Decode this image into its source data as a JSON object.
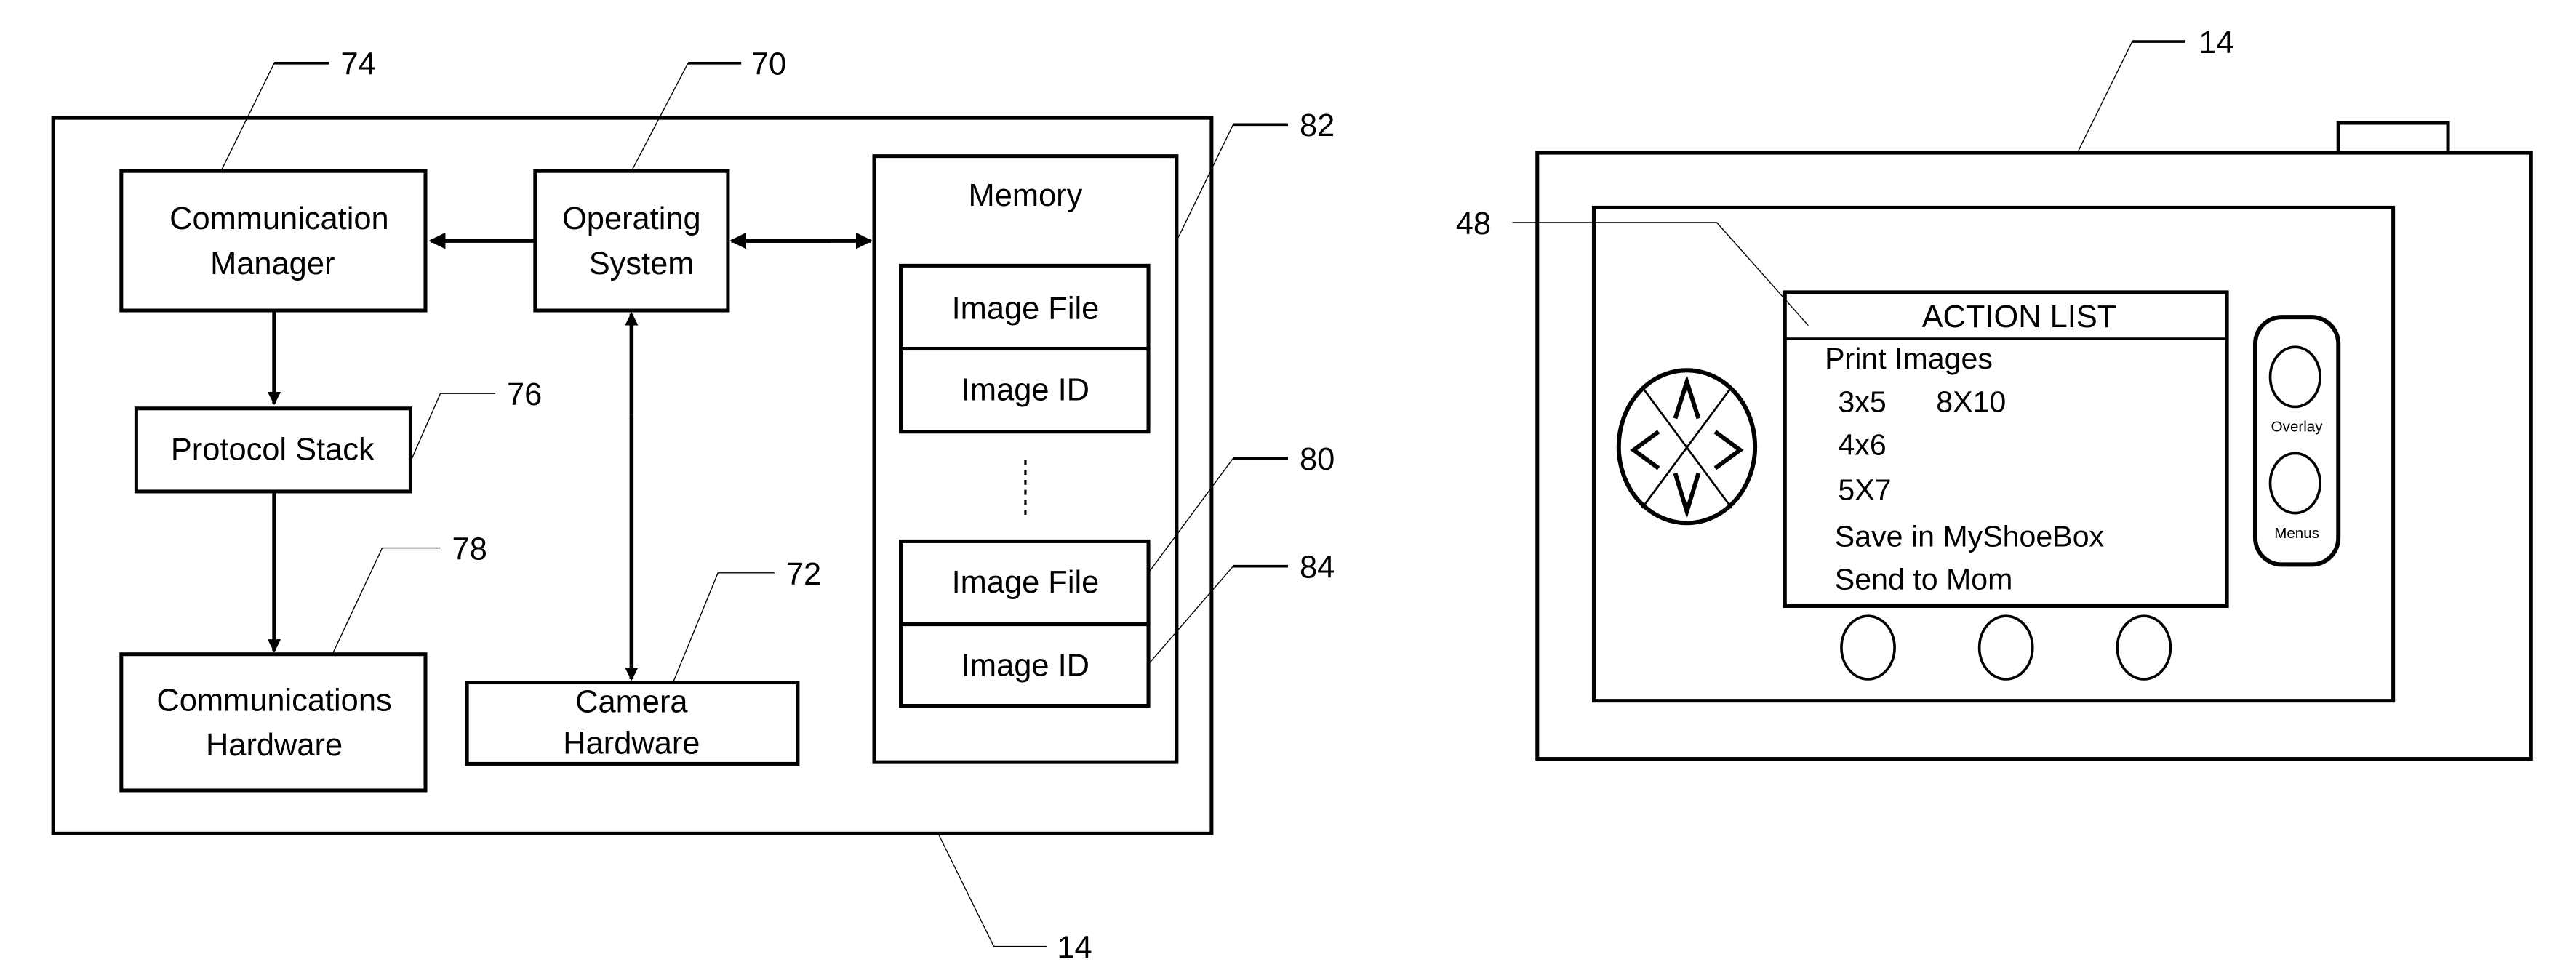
{
  "figure_left": {
    "device_ref": "14",
    "blocks": {
      "communication_manager": {
        "line1": "Communication",
        "line2": "Manager",
        "ref": "74"
      },
      "operating_system": {
        "line1": "Operating",
        "line2": "System",
        "ref": "70"
      },
      "protocol_stack": {
        "label": "Protocol Stack",
        "ref": "76"
      },
      "communications_hardware": {
        "line1": "Communications",
        "line2": "Hardware",
        "ref": "78"
      },
      "camera_hardware": {
        "line1": "Camera",
        "line2": "Hardware",
        "ref": "72"
      },
      "memory": {
        "label": "Memory",
        "ref": "82",
        "entries": [
          {
            "file": "Image File",
            "id": "Image ID"
          },
          {
            "file": "Image File",
            "id": "Image ID",
            "file_ref": "80",
            "id_ref": "84"
          }
        ]
      }
    }
  },
  "figure_right": {
    "device_ref": "14",
    "screen_ref": "48",
    "screen": {
      "title": "ACTION LIST",
      "items": [
        "Print Images",
        "3x5",
        "8X10",
        "4x6",
        "5X7",
        "Save in MyShoeBox",
        "Send to Mom"
      ]
    },
    "side_buttons": [
      "Overlay",
      "Menus"
    ]
  }
}
